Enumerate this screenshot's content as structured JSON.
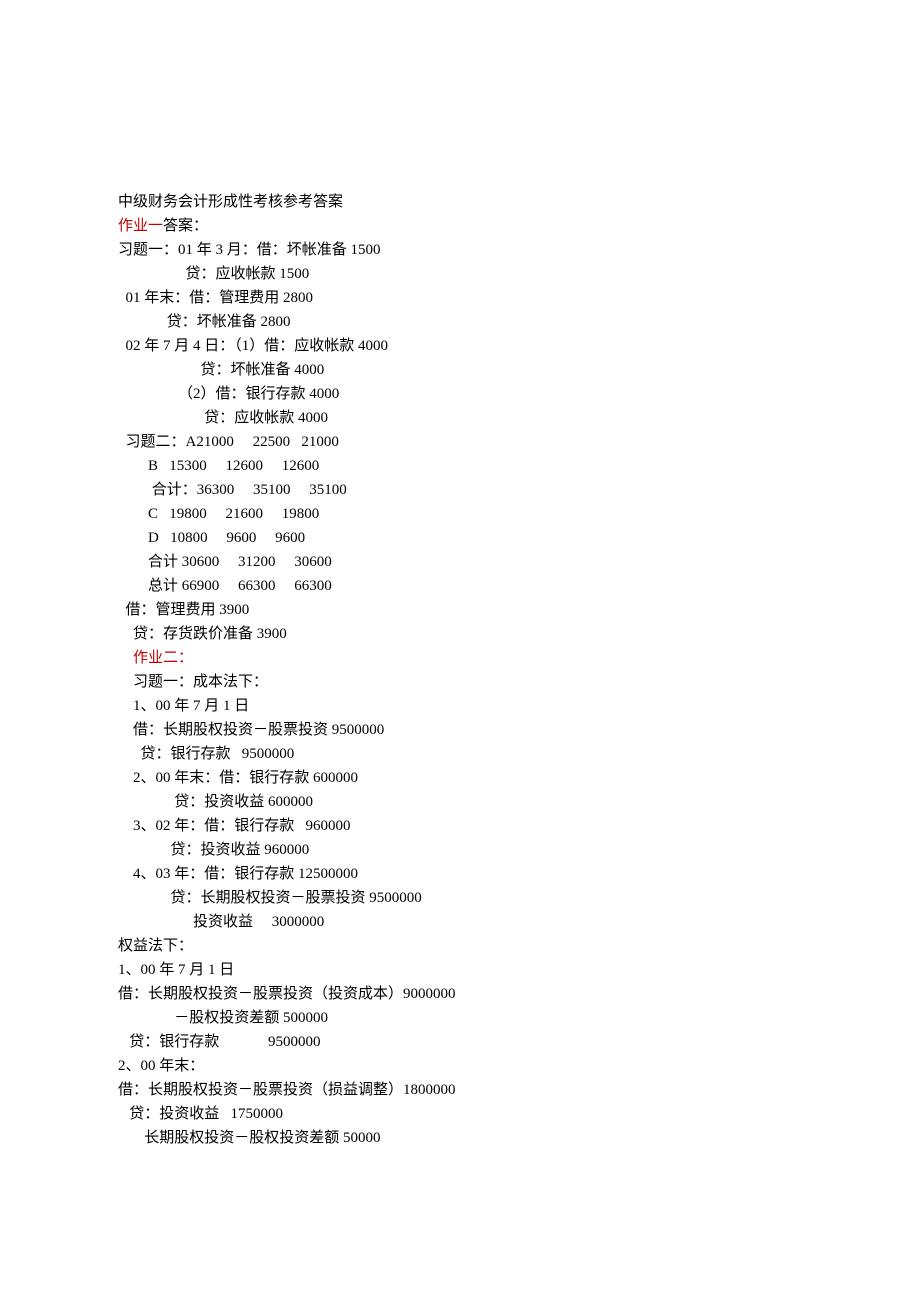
{
  "title": "中级财务会计形成性考核参考答案",
  "hw1_heading_a": "作业一",
  "hw1_heading_b": "答案：",
  "lines1": [
    "习题一：01 年 3 月：借：坏帐准备 1500",
    "                  贷：应收帐款 1500",
    "  01 年末：借：管理费用 2800",
    "             贷：坏帐准备 2800",
    "  02 年 7 月 4 日：（1）借：应收帐款 4000",
    "                      贷：坏帐准备 4000",
    "                （2）借：银行存款 4000",
    "                       贷：应收帐款 4000",
    "  习题二：A21000     22500   21000",
    "        B   15300     12600     12600",
    "         合计：36300     35100     35100",
    "        C   19800     21600     19800",
    "        D   10800     9600     9600",
    "        合计 30600     31200     30600",
    "        总计 66900     66300     66300",
    "  借：管理费用 3900",
    "    贷：存货跌价准备 3900"
  ],
  "hw2_heading": "    作业二：",
  "lines2": [
    "    习题一：成本法下：",
    "    1、00 年 7 月 1 日",
    "    借：长期股权投资－股票投资 9500000",
    "      贷：银行存款   9500000",
    "    2、00 年末：借：银行存款 600000",
    "               贷：投资收益 600000",
    "    3、02 年：借：银行存款   960000",
    "              贷：投资收益 960000",
    "    4、03 年：借：银行存款 12500000",
    "              贷：长期股权投资－股票投资 9500000",
    "                    投资收益     3000000",
    "权益法下：",
    "1、00 年 7 月 1 日",
    "借：长期股权投资－股票投资（投资成本）9000000",
    "               －股权投资差额 500000",
    "   贷：银行存款             9500000",
    "2、00 年末：",
    "借：长期股权投资－股票投资（损益调整）1800000",
    "   贷：投资收益   1750000",
    "       长期股权投资－股权投资差额 50000"
  ]
}
